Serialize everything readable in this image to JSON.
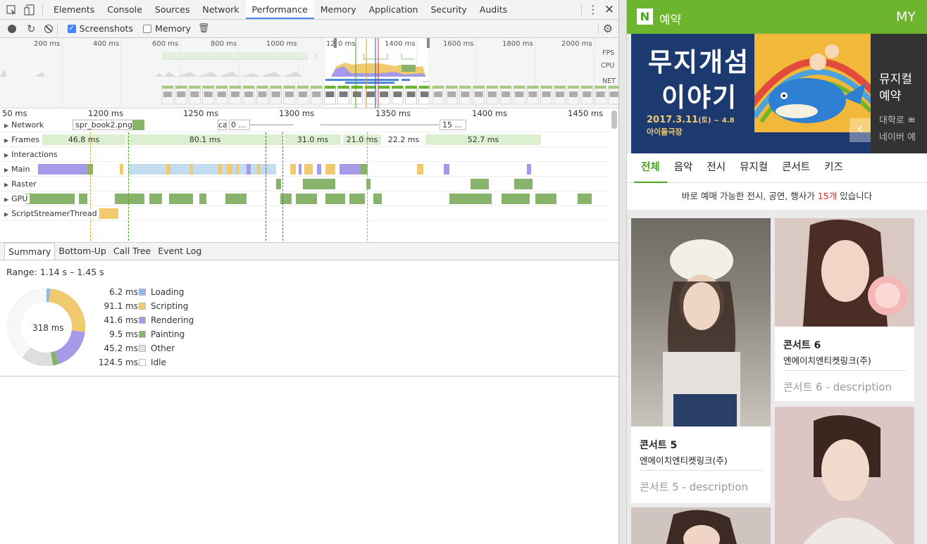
{
  "devtools": {
    "tabs": [
      "Elements",
      "Console",
      "Sources",
      "Network",
      "Performance",
      "Memory",
      "Application",
      "Security",
      "Audits"
    ],
    "active_tab": "Performance",
    "toolbar": {
      "screenshots_label": "Screenshots",
      "memory_label": "Memory"
    },
    "overview_ticks": [
      "200 ms",
      "400 ms",
      "600 ms",
      "800 ms",
      "1000 ms",
      "12",
      "0 ms",
      "1400 ms",
      "1600 ms",
      "1800 ms",
      "2000 ms"
    ],
    "overview_labels": {
      "fps": "FPS",
      "cpu": "CPU",
      "net": "NET"
    },
    "ruler_ticks": [
      "50 ms",
      "1200 ms",
      "1250 ms",
      "1300 ms",
      "1350 ms",
      "1400 ms",
      "1450 ms"
    ],
    "tracks": {
      "network": "Network",
      "frames": "Frames",
      "interactions": "Interactions",
      "main": "Main",
      "raster": "Raster",
      "gpu": "GPU",
      "script": "ScriptStreamerThread"
    },
    "network_items": [
      "spr_book2.png ...",
      "ca",
      "0 ...",
      "15 ..."
    ],
    "frame_times": [
      "46.8 ms",
      "80.1 ms",
      "31.0 ms",
      "21.0 ms",
      "22.2 ms",
      "52.7 ms"
    ],
    "bottom_tabs": [
      "Summary",
      "Bottom-Up",
      "Call Tree",
      "Event Log"
    ],
    "summary": {
      "range": "Range: 1.14 s – 1.45 s",
      "total": "318 ms",
      "rows": [
        {
          "ms": "6.2 ms",
          "name": "Loading",
          "color": "#8fb7ea"
        },
        {
          "ms": "91.1 ms",
          "name": "Scripting",
          "color": "#f1c96e"
        },
        {
          "ms": "41.6 ms",
          "name": "Rendering",
          "color": "#a59ae8"
        },
        {
          "ms": "9.5 ms",
          "name": "Painting",
          "color": "#87b46a"
        },
        {
          "ms": "45.2 ms",
          "name": "Other",
          "color": "#dedede"
        },
        {
          "ms": "124.5 ms",
          "name": "Idle",
          "color": "#ffffff"
        }
      ]
    }
  },
  "app": {
    "logo": "N",
    "title": "예약",
    "my": "MY",
    "banner": {
      "title_line1": "무지개섬",
      "title_line2": "이야기",
      "date": "2017.3.11",
      "date_suffix": "(토) ~ 4.8",
      "venue": "아이들극장",
      "side_title1": "뮤지컬",
      "side_title2": "예약",
      "side_sub1": "대학로 ㅃ",
      "side_sub2": "네이버 예"
    },
    "categories": [
      "전체",
      "음악",
      "전시",
      "뮤지컬",
      "콘서트",
      "키즈"
    ],
    "notice_prefix": "바로 예매 가능한 전시, 공연, 행사가 ",
    "notice_count": "15개",
    "notice_suffix": " 있습니다",
    "cards": [
      {
        "title": "콘서트 5",
        "sub": "엔에이치엔티켓링크(주)",
        "desc": "콘서트 5 - description"
      },
      {
        "title": "콘서트 6",
        "sub": "엔에이치엔티켓링크(주)",
        "desc": "콘서트 6 - description"
      }
    ]
  }
}
